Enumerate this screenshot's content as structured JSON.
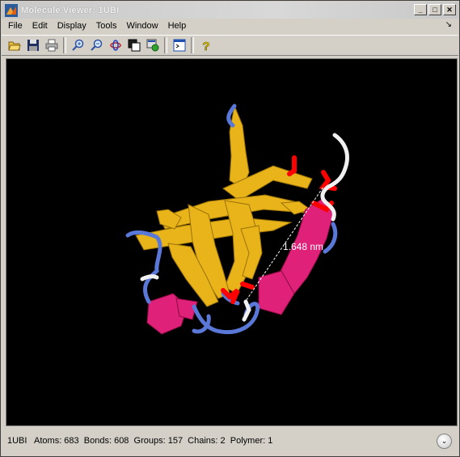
{
  "window": {
    "title": "Molecule Viewer: 1UBI",
    "controls": {
      "minimize": "_",
      "maximize": "□",
      "close": "✕"
    }
  },
  "menubar": {
    "items": [
      "File",
      "Edit",
      "Display",
      "Tools",
      "Window",
      "Help"
    ],
    "dock_glyph": "↘"
  },
  "toolbar": {
    "buttons": [
      "open-file-icon",
      "save-icon",
      "print-icon",
      "zoom-in-icon",
      "zoom-out-icon",
      "rotate-icon",
      "copy-figure-icon",
      "export-icon",
      "console-icon",
      "help-icon"
    ]
  },
  "viewport": {
    "background": "#000000",
    "measurement_label": "1.648 nm",
    "colors": {
      "sheet": "#e8b41a",
      "helix": "#e0217a",
      "coil": "#5a78d8",
      "sidechain": "#ff0000",
      "terminal": "#ffffff"
    }
  },
  "statusbar": {
    "text": "1UBI   Atoms: 683  Bonds: 608  Groups: 157  Chains: 2  Polymer: 1",
    "menu_glyph": "⌄"
  }
}
